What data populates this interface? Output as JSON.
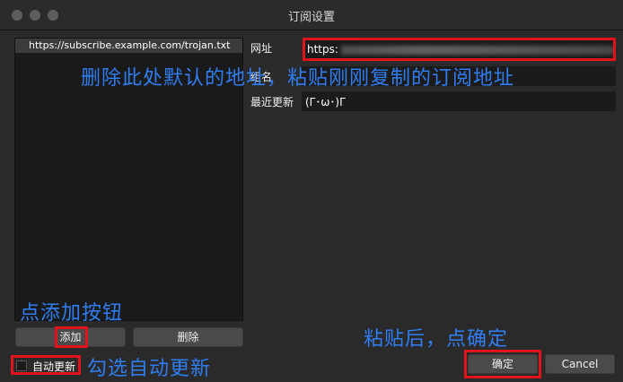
{
  "window": {
    "title": "订阅设置"
  },
  "subscriptions": {
    "items": [
      {
        "label": "https://subscribe.example.com/trojan.txt"
      }
    ],
    "add_label": "添加",
    "delete_label": "删除",
    "auto_update_label": "自动更新",
    "auto_update_checked": false
  },
  "form": {
    "url_label": "网址",
    "url_value": "https:",
    "group_label": "组名",
    "group_value": "",
    "last_update_label": "最近更新",
    "last_update_value": "(Γ･ω･)Γ"
  },
  "footer": {
    "confirm_label": "确定",
    "cancel_label": "Cancel"
  },
  "annotations": {
    "replace_url": "删除此处默认的地址，粘贴刚刚复制的订阅地址",
    "click_add": "点添加按钮",
    "paste_confirm": "粘贴后，点确定",
    "check_auto": "勾选自动更新"
  },
  "colors": {
    "highlight": "#e0141a",
    "annotation": "#2f7df0"
  }
}
